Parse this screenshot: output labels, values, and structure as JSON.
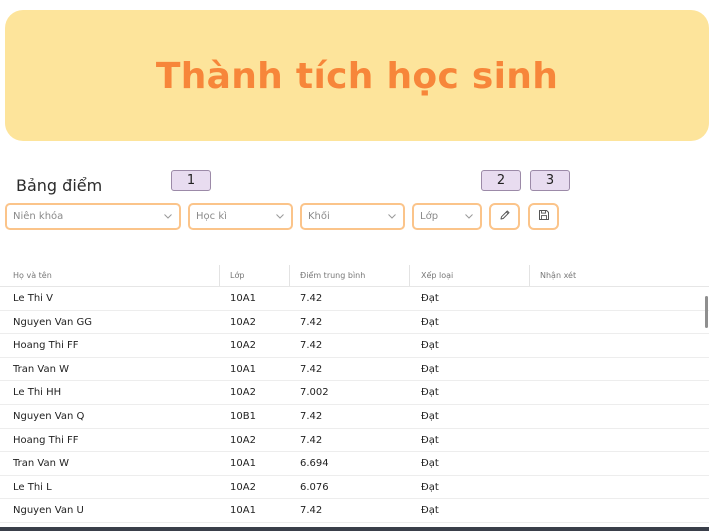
{
  "banner": {
    "title": "Thành tích học sinh"
  },
  "section": {
    "title": "Bảng điểm"
  },
  "callouts": [
    "1",
    "2",
    "3"
  ],
  "filters": {
    "school_year_placeholder": "Niên khóa",
    "term_placeholder": "Học kì",
    "grade_placeholder": "Khối",
    "class_placeholder": "Lớp"
  },
  "actions": {
    "edit_icon": "pencil-icon",
    "save_icon": "floppy-disk-icon"
  },
  "colors": {
    "accent": "#f7863a",
    "banner_bg": "#fde49b",
    "field_border": "#fbc48a"
  },
  "table": {
    "headers": {
      "name": "Họ và tên",
      "class": "Lớp",
      "average": "Điểm trung bình",
      "rank": "Xếp loại",
      "comment": "Nhận xét"
    },
    "rows": [
      {
        "name": "Le Thi V",
        "class": "10A1",
        "average": "7.42",
        "rank": "Đạt",
        "comment": ""
      },
      {
        "name": "Nguyen Van GG",
        "class": "10A2",
        "average": "7.42",
        "rank": "Đạt",
        "comment": ""
      },
      {
        "name": "Hoang Thi FF",
        "class": "10A2",
        "average": "7.42",
        "rank": "Đạt",
        "comment": ""
      },
      {
        "name": "Tran Van W",
        "class": "10A1",
        "average": "7.42",
        "rank": "Đạt",
        "comment": ""
      },
      {
        "name": "Le Thi HH",
        "class": "10A2",
        "average": "7.002",
        "rank": "Đạt",
        "comment": ""
      },
      {
        "name": "Nguyen Van Q",
        "class": "10B1",
        "average": "7.42",
        "rank": "Đạt",
        "comment": ""
      },
      {
        "name": "Hoang Thi FF",
        "class": "10A2",
        "average": "7.42",
        "rank": "Đạt",
        "comment": ""
      },
      {
        "name": "Tran Van W",
        "class": "10A1",
        "average": "6.694",
        "rank": "Đạt",
        "comment": ""
      },
      {
        "name": "Le Thi L",
        "class": "10A2",
        "average": "6.076",
        "rank": "Đạt",
        "comment": ""
      },
      {
        "name": "Nguyen Van U",
        "class": "10A1",
        "average": "7.42",
        "rank": "Đạt",
        "comment": ""
      }
    ]
  }
}
